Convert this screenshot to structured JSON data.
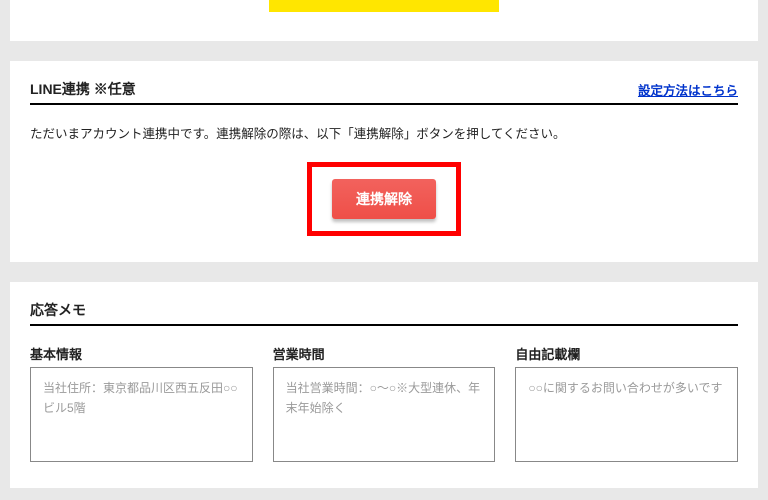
{
  "lineSection": {
    "title": "LINE連携 ※任意",
    "helpLink": "設定方法はこちら",
    "description": "ただいまアカウント連携中です。連携解除の際は、以下「連携解除」ボタンを押してください。",
    "unlinkButton": "連携解除"
  },
  "memoSection": {
    "title": "応答メモ",
    "columns": [
      {
        "label": "基本情報",
        "placeholder": "当社住所：東京都品川区西五反田○○ビル5階"
      },
      {
        "label": "営業時間",
        "placeholder": "当社営業時間：○～○※大型連休、年末年始除く"
      },
      {
        "label": "自由記載欄",
        "placeholder": "○○に関するお問い合わせが多いです"
      }
    ]
  }
}
